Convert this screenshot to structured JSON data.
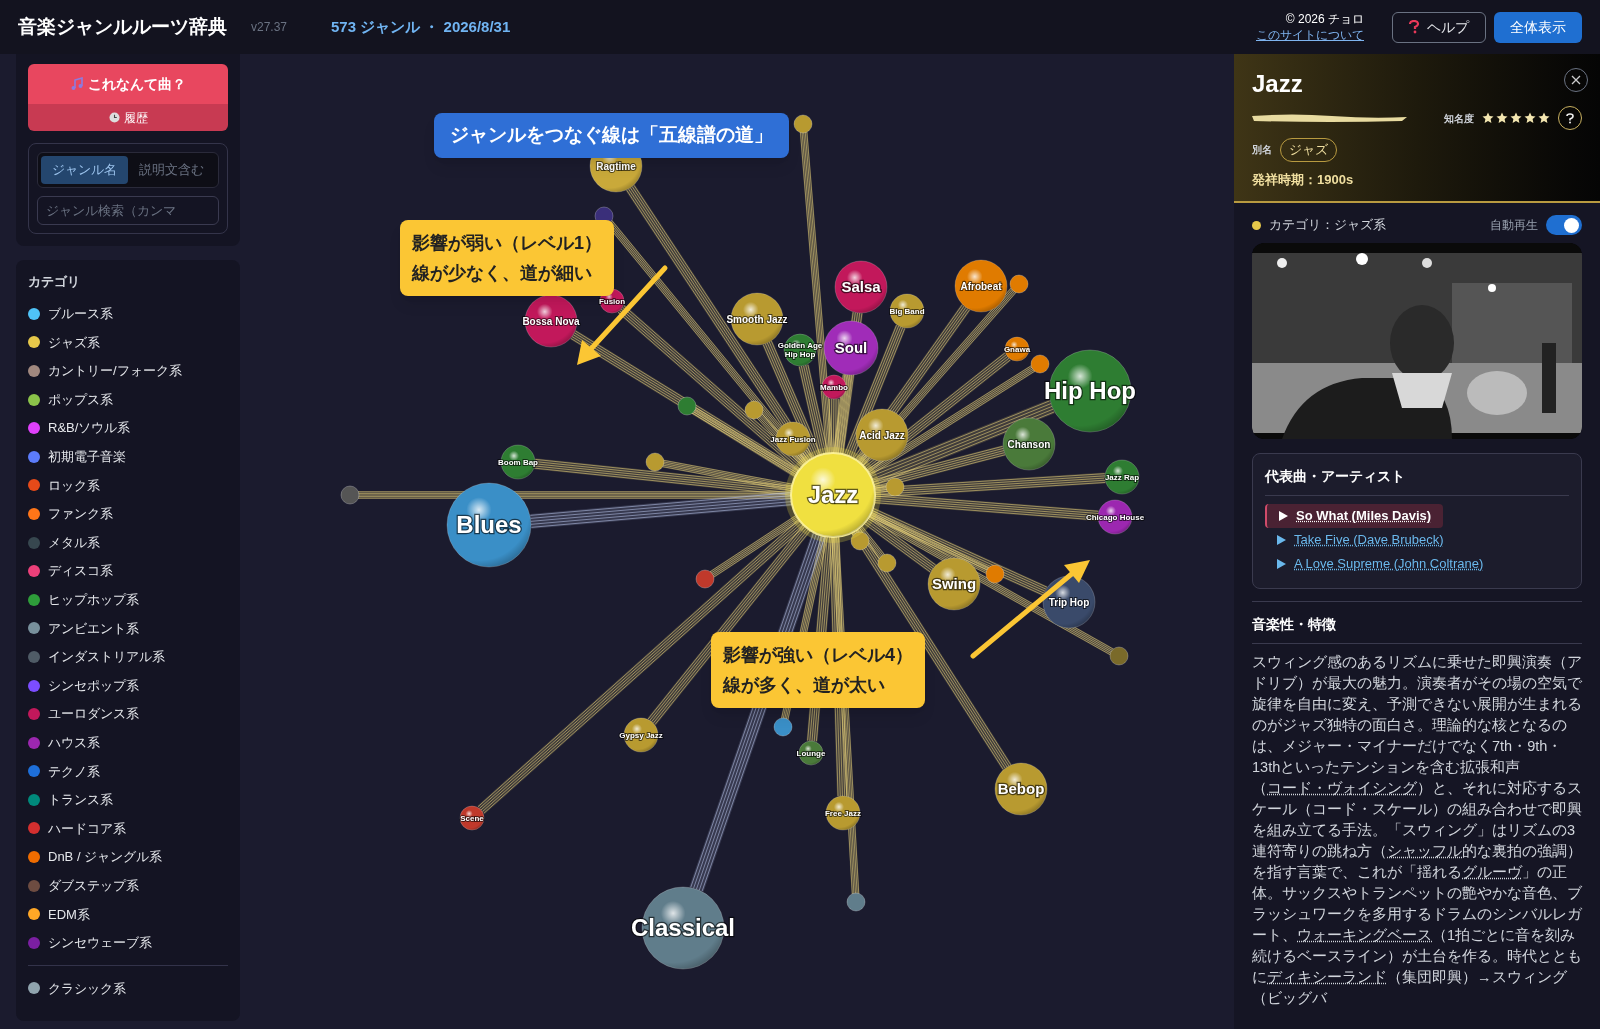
{
  "header": {
    "title": "音楽ジャンルルーツ辞典",
    "version": "v27.37",
    "stats": "573 ジャンル ・ 2026/8/31",
    "copyright": "© 2026 チョロ",
    "about_link": "このサイトについて",
    "help_button": "ヘルプ",
    "fit_button": "全体表示"
  },
  "sidebar": {
    "quiz_button": "これなんて曲？",
    "history_button": "履歴",
    "search_tabs": [
      {
        "label": "ジャンル名",
        "selected": true
      },
      {
        "label": "説明文含む",
        "selected": false
      }
    ],
    "search": {
      "placeholder": "ジャンル検索（カンマ"
    },
    "category_heading": "カテゴリ",
    "categories": [
      {
        "label": "ブルース系",
        "color": "#4fc3f7"
      },
      {
        "label": "ジャズ系",
        "color": "#e6c84a"
      },
      {
        "label": "カントリー/フォーク系",
        "color": "#a1887f"
      },
      {
        "label": "ポップス系",
        "color": "#8bc34a"
      },
      {
        "label": "R&B/ソウル系",
        "color": "#e040fb"
      },
      {
        "label": "初期電子音楽",
        "color": "#5c7cfa"
      },
      {
        "label": "ロック系",
        "color": "#e64a19"
      },
      {
        "label": "ファンク系",
        "color": "#ff7518"
      },
      {
        "label": "メタル系",
        "color": "#37474f"
      },
      {
        "label": "ディスコ系",
        "color": "#ec407a"
      },
      {
        "label": "ヒップホップ系",
        "color": "#2e9d3a"
      },
      {
        "label": "アンビエント系",
        "color": "#78909c"
      },
      {
        "label": "インダストリアル系",
        "color": "#4f5b66"
      },
      {
        "label": "シンセポップ系",
        "color": "#7c4dff"
      },
      {
        "label": "ユーロダンス系",
        "color": "#c2185b"
      },
      {
        "label": "ハウス系",
        "color": "#9c27b0"
      },
      {
        "label": "テクノ系",
        "color": "#1e6fd9"
      },
      {
        "label": "トランス系",
        "color": "#00897b"
      },
      {
        "label": "ハードコア系",
        "color": "#d32f2f"
      },
      {
        "label": "DnB / ジャングル系",
        "color": "#ef6c00"
      },
      {
        "label": "ダブステップ系",
        "color": "#6d4c41"
      },
      {
        "label": "EDM系",
        "color": "#ffa726"
      },
      {
        "label": "シンセウェーブ系",
        "color": "#7b1fa2"
      },
      {
        "label": "クラシック系",
        "color": "#90a4ae"
      }
    ]
  },
  "graph": {
    "nodes": [
      {
        "label": "Ragtime",
        "color": "#c9a93a",
        "selected": false
      },
      {
        "label": "Fusion",
        "color": "#c2185b",
        "selected": false
      },
      {
        "label": "Bossa Nova",
        "color": "#c2185b",
        "selected": false
      },
      {
        "label": "Salsa",
        "color": "#c2185b",
        "selected": false
      },
      {
        "label": "Afrobeat",
        "color": "#e07b00",
        "selected": false
      },
      {
        "label": "Big Band",
        "color": "#b89a30",
        "selected": false
      },
      {
        "label": "Smooth Jazz",
        "color": "#b89a30",
        "selected": false
      },
      {
        "label": "Golden Age Hip Hop",
        "color": "#2e7d32",
        "selected": false
      },
      {
        "label": "Soul",
        "color": "#a02cb8",
        "selected": false
      },
      {
        "label": "Gnawa",
        "color": "#e07b00",
        "selected": false
      },
      {
        "label": "Mambo",
        "color": "#c2185b",
        "selected": false
      },
      {
        "label": "Hip Hop",
        "color": "#2e7d32",
        "selected": false
      },
      {
        "label": "Jazz Fusion",
        "color": "#b89a30",
        "selected": false
      },
      {
        "label": "Acid Jazz",
        "color": "#b89a30",
        "selected": false
      },
      {
        "label": "Chanson",
        "color": "#4a7a3a",
        "selected": false
      },
      {
        "label": "Boom Bap",
        "color": "#2e7d32",
        "selected": false
      },
      {
        "label": "Blues",
        "color": "#3a8fc7",
        "selected": false
      },
      {
        "label": "Jazz",
        "color": "#f0e040",
        "selected": true
      },
      {
        "label": "Jazz Rap",
        "color": "#2e7d32",
        "selected": false
      },
      {
        "label": "Chicago House",
        "color": "#9c27b0",
        "selected": false
      },
      {
        "label": "Swing",
        "color": "#b89a30",
        "selected": false
      },
      {
        "label": "Trip Hop",
        "color": "#3a4a6a",
        "selected": false
      },
      {
        "label": "Gypsy Jazz",
        "color": "#b89a30",
        "selected": false
      },
      {
        "label": "Lounge",
        "color": "#4a7a3a",
        "selected": false
      },
      {
        "label": "Bebop",
        "color": "#b89a30",
        "selected": false
      },
      {
        "label": "Free Jazz",
        "color": "#b89a30",
        "selected": false
      },
      {
        "label": "Scene",
        "color": "#c0392b",
        "selected": false
      },
      {
        "label": "Classical",
        "color": "#607d8b",
        "selected": false
      }
    ],
    "callouts": [
      {
        "kind": "info",
        "lines": [
          "ジャンルをつなぐ線は「五線譜の道」"
        ]
      },
      {
        "kind": "note",
        "lines": [
          "影響が弱い（レベル1）",
          "線が少なく、道が細い"
        ]
      },
      {
        "kind": "note",
        "lines": [
          "影響が強い（レベル4）",
          "線が多く、道が太い"
        ]
      }
    ]
  },
  "detail": {
    "title": "Jazz",
    "fame_label": "知名度",
    "stars": 5,
    "alias_label": "別名",
    "alias": "ジャズ",
    "origin": "発祥時期：1900s",
    "category": {
      "label": "カテゴリ：ジャズ系",
      "color": "#e6c84a"
    },
    "autoplay": {
      "label": "自動再生",
      "on": true
    },
    "songs_heading": "代表曲・アーティスト",
    "songs": [
      {
        "label": "So What (Miles Davis)",
        "selected": true
      },
      {
        "label": "Take Five (Dave Brubeck)",
        "selected": false
      },
      {
        "label": "A Love Supreme (John Coltrane)",
        "selected": false
      }
    ],
    "features_heading": "音楽性・特徴",
    "features": [
      {
        "text": "スウィング感のあるリズムに乗せた即興演奏（アドリブ）が最大の魅力。演奏者がその場の空気で旋律を自由に変え、予測できない展開が生まれるのがジャズ独特の面白さ。理論的な核となるのは、メジャー・マイナーだけでなく7th・9th・13thといったテンションを含む拡張和声（",
        "term": false
      },
      {
        "text": "コード・ヴォイシング",
        "term": true
      },
      {
        "text": "）と、それに対応するスケール（コード・スケール）の組み合わせで即興を組み立てる手法。「スウィング」はリズムの3連符寄りの跳ね方（",
        "term": false
      },
      {
        "text": "シャッフル",
        "term": true
      },
      {
        "text": "的な裏拍の強調）を指す言葉で、これが「揺れる",
        "term": false
      },
      {
        "text": "グルーヴ",
        "term": true
      },
      {
        "text": "」の正体。サックスやトランペットの艶やかな音色、ブラッシュワークを多用するドラムのシンバルレガート、",
        "term": false
      },
      {
        "text": "ウォーキングベース",
        "term": true
      },
      {
        "text": "（1拍ごとに音を刻み続けるベースライン）が土台を作る。時代とともに",
        "term": false
      },
      {
        "text": "ディキシーランド",
        "term": true
      },
      {
        "text": "（集団即興）→スウィング（ビッグバ",
        "term": false
      }
    ]
  }
}
